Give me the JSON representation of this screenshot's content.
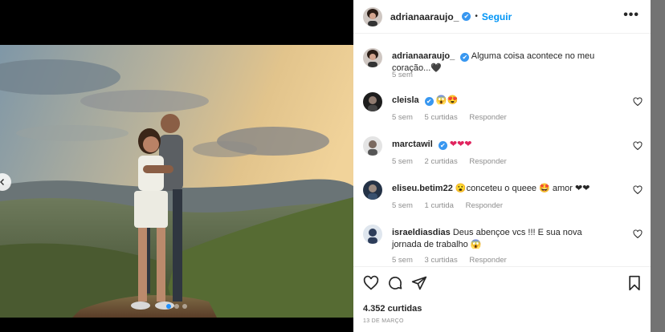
{
  "post": {
    "author": "adrianaaraujo_",
    "separator": "•",
    "follow_label": "Seguir",
    "more_label": "•••",
    "verified_glyph": "✔"
  },
  "caption": {
    "username": "adrianaaraujo_",
    "text": "Alguma coisa acontece no meu coração...🖤",
    "time": "5 sem"
  },
  "comments": [
    {
      "username": "cleisla",
      "verified": true,
      "text": "😱😍",
      "time": "5 sem",
      "likes": "5 curtidas",
      "reply": "Responder"
    },
    {
      "username": "marctawil",
      "verified": true,
      "text": "❤❤❤",
      "time": "5 sem",
      "likes": "2 curtidas",
      "reply": "Responder"
    },
    {
      "username": "eliseu.betim22",
      "verified": false,
      "text": "😮conceteu o queee 🤩 amor ❤❤",
      "time": "5 sem",
      "likes": "1 curtida",
      "reply": "Responder"
    },
    {
      "username": "israeldiasdias",
      "verified": false,
      "text": "Deus abençoe vcs !!! E sua nova jornada de trabalho 😱",
      "time": "5 sem",
      "likes": "3 curtidas",
      "reply": "Responder"
    }
  ],
  "stats": {
    "likes": "4.352 curtidas",
    "date": "13 DE MARÇO"
  },
  "carousel": {
    "slides": 3,
    "active": 1
  },
  "icons": [
    "heart-icon",
    "comment-icon",
    "share-icon",
    "bookmark-icon",
    "more-icon",
    "verified-icon",
    "chevron-left-icon"
  ],
  "colors": {
    "accent": "#0095f6",
    "verified": "#3897f0",
    "muted": "#8e8e8e",
    "backdrop": "#737373"
  }
}
